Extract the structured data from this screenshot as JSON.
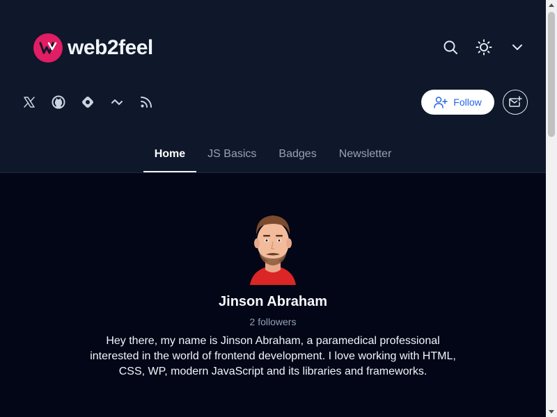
{
  "header": {
    "logo_text": "web2feel",
    "top_icons": [
      "search-icon",
      "sun-icon",
      "chevron-down-icon"
    ],
    "social_icons": [
      "x-icon",
      "github-icon",
      "hashnode-icon",
      "devto-link-icon",
      "rss-icon"
    ],
    "follow_label": "Follow",
    "newsletter_icon": "mail-plus-icon"
  },
  "nav": {
    "tabs": [
      {
        "label": "Home",
        "active": true
      },
      {
        "label": "JS Basics",
        "active": false
      },
      {
        "label": "Badges",
        "active": false
      },
      {
        "label": "Newsletter",
        "active": false
      }
    ]
  },
  "profile": {
    "name": "Jinson Abraham",
    "followers": "2 followers",
    "bio": "Hey there, my name is Jinson Abraham, a paramedical professional interested in the world of frontend development. I love working with HTML, CSS, WP, modern JavaScript and its libraries and frameworks."
  },
  "colors": {
    "header_bg": "#0f172a",
    "page_bg": "#020617",
    "brand": "#e11d63",
    "follow_text": "#2563eb"
  }
}
